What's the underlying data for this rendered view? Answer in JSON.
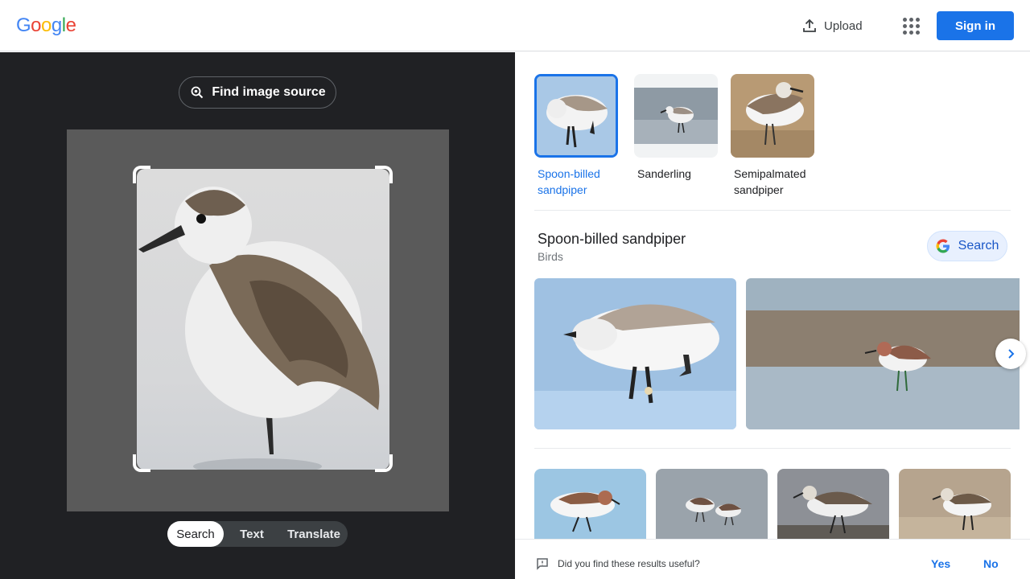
{
  "header": {
    "logo_letters": [
      "G",
      "o",
      "o",
      "g",
      "l",
      "e"
    ],
    "logo_colors": [
      "#4285f4",
      "#ea4335",
      "#fbbc05",
      "#4285f4",
      "#34a853",
      "#ea4335"
    ],
    "upload_label": "Upload",
    "signin_label": "Sign in",
    "accent": "#1a73e8"
  },
  "lens": {
    "find_source_label": "Find image source",
    "modes": [
      "Search",
      "Text",
      "Translate"
    ],
    "active_mode": "Search"
  },
  "matches": [
    {
      "label": "Spoon-billed sandpiper",
      "selected": true
    },
    {
      "label": "Sanderling",
      "selected": false
    },
    {
      "label": "Semipalmated sandpiper",
      "selected": false
    }
  ],
  "knowledge_panel": {
    "title": "Spoon-billed sandpiper",
    "subtitle": "Birds",
    "search_label": "Search"
  },
  "feedback": {
    "question": "Did you find these results useful?",
    "yes": "Yes",
    "no": "No"
  }
}
